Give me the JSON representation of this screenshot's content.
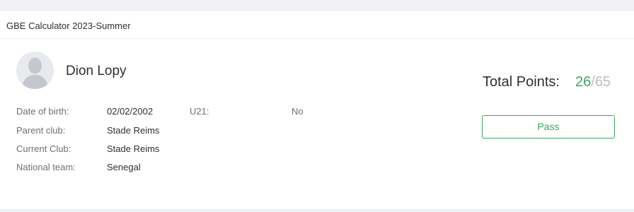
{
  "card": {
    "title": "GBE Calculator 2023-Summer"
  },
  "player": {
    "name": "Dion Lopy",
    "avatar_icon": "user-silhouette-icon"
  },
  "details": {
    "date_of_birth_label": "Date of birth:",
    "date_of_birth_value": "02/02/2002",
    "u21_label": "U21:",
    "u21_value": "No",
    "parent_club_label": "Parent club:",
    "parent_club_value": "Stade Reims",
    "current_club_label": "Current Club:",
    "current_club_value": "Stade Reims",
    "national_team_label": "National team:",
    "national_team_value": "Senegal"
  },
  "score": {
    "label": "Total Points:",
    "points": "26",
    "separator": "/",
    "max": "65"
  },
  "result": {
    "button_label": "Pass"
  },
  "colors": {
    "accent_green": "#3aa664",
    "muted_gray": "#b9bdc4"
  }
}
